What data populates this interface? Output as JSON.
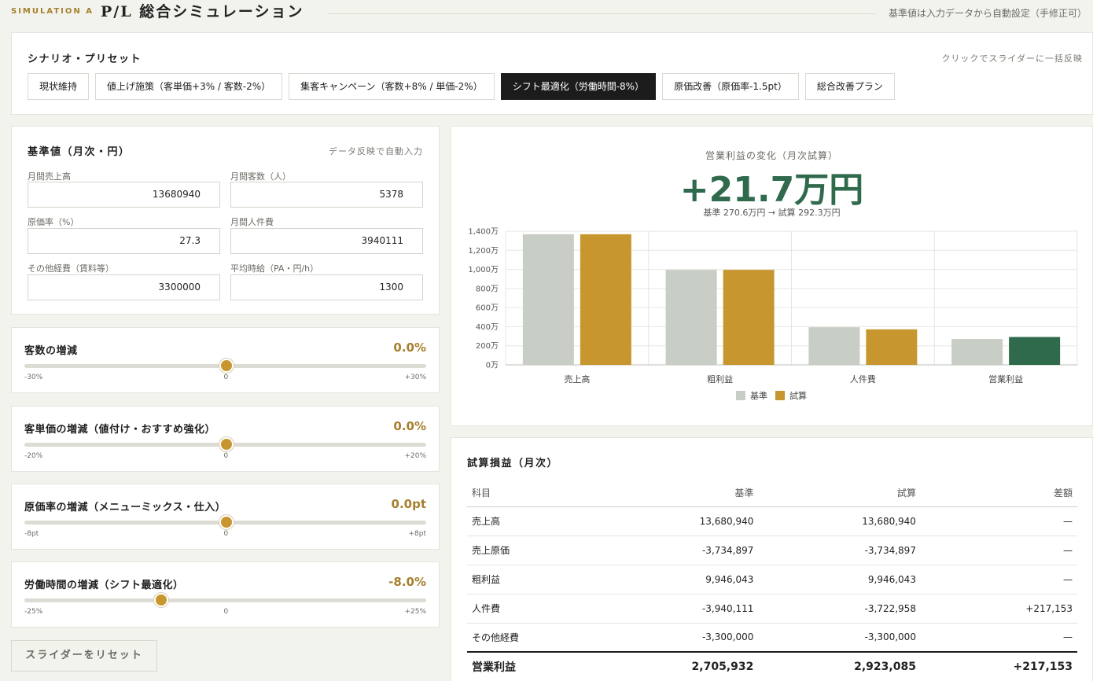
{
  "header": {
    "sim_label": "SIMULATION A",
    "title": "P/L 総合シミュレーション",
    "note": "基準値は入力データから自動設定（手修正可）"
  },
  "scenario": {
    "title": "シナリオ・プリセット",
    "note": "クリックでスライダーに一括反映",
    "presets": [
      {
        "label": "現状維持",
        "active": false
      },
      {
        "label": "値上げ施策（客単価+3% / 客数-2%）",
        "active": false
      },
      {
        "label": "集客キャンペーン（客数+8% / 単価-2%）",
        "active": false
      },
      {
        "label": "シフト最適化（労働時間-8%）",
        "active": true
      },
      {
        "label": "原価改善（原価率-1.5pt）",
        "active": false
      },
      {
        "label": "総合改善プラン",
        "active": false
      }
    ]
  },
  "base": {
    "title": "基準値（月次・円）",
    "note": "データ反映で自動入力",
    "fields": [
      {
        "label": "月間売上高",
        "value": "13680940"
      },
      {
        "label": "月間客数（人）",
        "value": "5378"
      },
      {
        "label": "原価率（%）",
        "value": "27.3"
      },
      {
        "label": "月間人件費",
        "value": "3940111"
      },
      {
        "label": "その他経費（賃料等）",
        "value": "3300000"
      },
      {
        "label": "平均時給（PA・円/h）",
        "value": "1300"
      }
    ]
  },
  "sliders": [
    {
      "title": "客数の増減",
      "value": "0.0%",
      "min": "-30%",
      "mid": "0",
      "max": "+30%",
      "level": 0.5
    },
    {
      "title": "客単価の増減（値付け・おすすめ強化）",
      "value": "0.0%",
      "min": "-20%",
      "mid": "0",
      "max": "+20%",
      "level": 0.5
    },
    {
      "title": "原価率の増減（メニューミックス・仕入）",
      "value": "0.0pt",
      "min": "-8pt",
      "mid": "0",
      "max": "+8pt",
      "level": 0.5
    },
    {
      "title": "労働時間の増減（シフト最適化）",
      "value": "-8.0%",
      "min": "-25%",
      "mid": "0",
      "max": "+25%",
      "level": 0.34
    }
  ],
  "reset_label": "スライダーをリセット",
  "summary": {
    "subtitle": "営業利益の変化（月次試算）",
    "big_value": "+21.7万円",
    "compare": "基準 270.6万円 → 試算 292.3万円"
  },
  "colors": {
    "base": "#c8cdc6",
    "trial": "#c8962e",
    "trial_positive": "#2f6a4c",
    "accent_gold": "#a57f2c"
  },
  "chart_data": {
    "type": "bar",
    "categories": [
      "売上高",
      "粗利益",
      "人件費",
      "営業利益"
    ],
    "series": [
      {
        "name": "基準",
        "values": [
          1368,
          995,
          394,
          271
        ]
      },
      {
        "name": "試算",
        "values": [
          1368,
          995,
          372,
          292
        ]
      }
    ],
    "ylim": [
      0,
      1400
    ],
    "yticks": [
      "0万",
      "200万",
      "400万",
      "600万",
      "800万",
      "1,000万",
      "1,200万",
      "1,400万"
    ],
    "grid": true,
    "legend": "bottom"
  },
  "table": {
    "title": "試算損益（月次）",
    "headers": [
      "科目",
      "基準",
      "試算",
      "差額"
    ],
    "rows": [
      [
        "売上高",
        "13,680,940",
        "13,680,940",
        "—"
      ],
      [
        "売上原価",
        "-3,734,897",
        "-3,734,897",
        "—"
      ],
      [
        "粗利益",
        "9,946,043",
        "9,946,043",
        "—"
      ],
      [
        "人件費",
        "-3,940,111",
        "-3,722,958",
        "+217,153"
      ],
      [
        "その他経費",
        "-3,300,000",
        "-3,300,000",
        "—"
      ]
    ],
    "total": [
      "営業利益",
      "2,705,932",
      "2,923,085",
      "+217,153"
    ]
  }
}
